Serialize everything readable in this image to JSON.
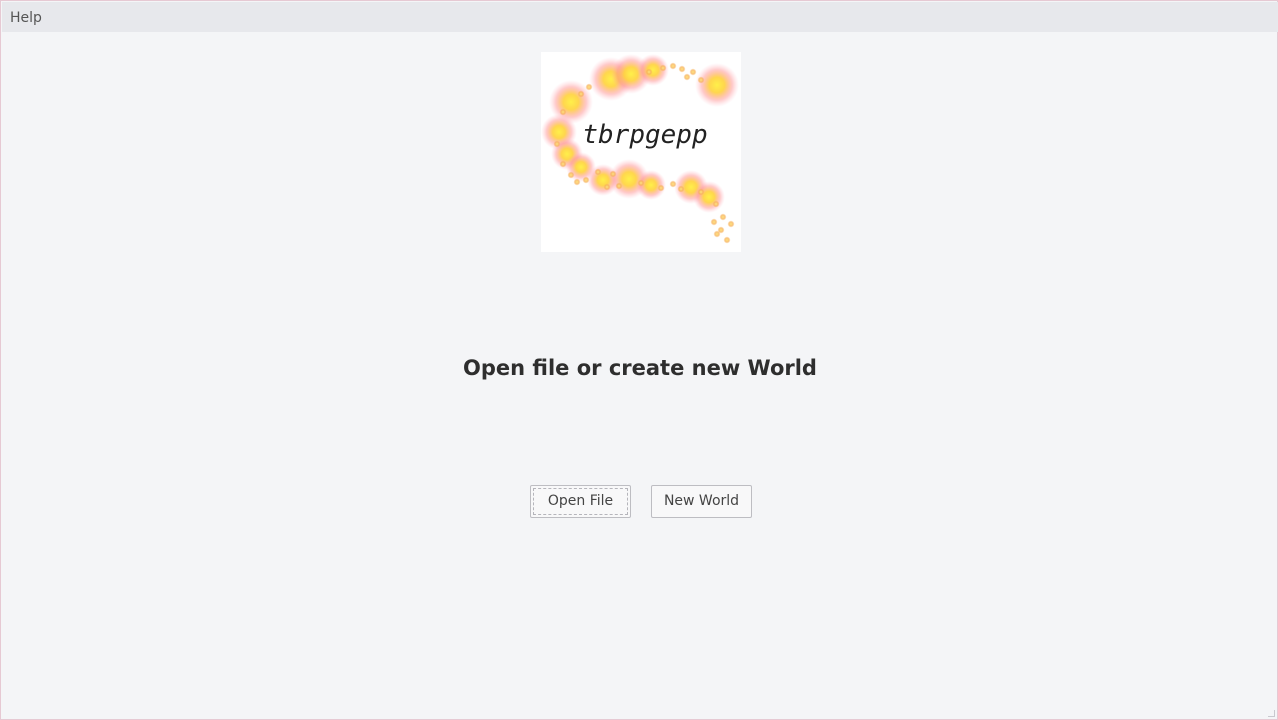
{
  "menubar": {
    "items": [
      {
        "label": "Help"
      }
    ]
  },
  "logo": {
    "text": "tbrpgepp"
  },
  "main": {
    "heading": "Open file or create new World",
    "open_button_label": "Open File",
    "new_button_label": "New World"
  },
  "colors": {
    "background": "#f4f5f7",
    "menubar": "#e7e8ec",
    "window_border": "#e6c9d3",
    "logo_glow_core": "#fff04a",
    "logo_glow_outer": "#ff8a8a"
  }
}
